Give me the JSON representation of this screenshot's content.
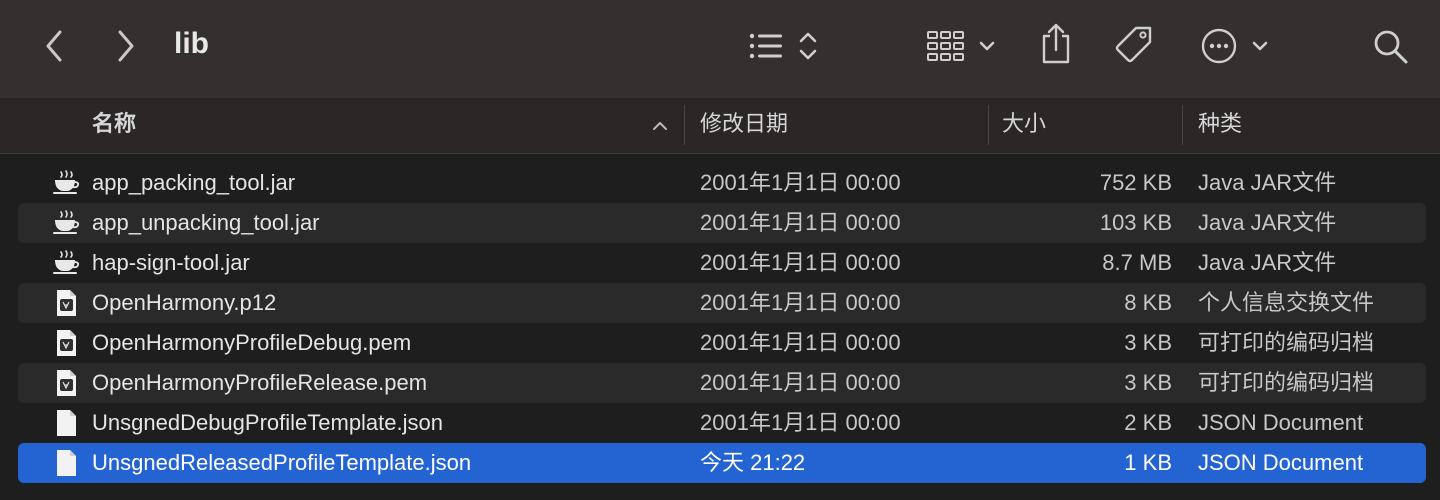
{
  "toolbar": {
    "title": "lib",
    "icons": [
      "back-icon",
      "forward-icon",
      "list-view-icon",
      "grid-view-icon",
      "share-icon",
      "tag-icon",
      "more-icon",
      "search-icon"
    ]
  },
  "columns": {
    "name": "名称",
    "date": "修改日期",
    "size": "大小",
    "kind": "种类"
  },
  "files": [
    {
      "name": "app_packing_tool.jar",
      "date": "2001年1月1日 00:00",
      "size": "752 KB",
      "kind": "Java JAR文件",
      "icon": "java-icon"
    },
    {
      "name": "app_unpacking_tool.jar",
      "date": "2001年1月1日 00:00",
      "size": "103 KB",
      "kind": "Java JAR文件",
      "icon": "java-icon"
    },
    {
      "name": "hap-sign-tool.jar",
      "date": "2001年1月1日 00:00",
      "size": "8.7 MB",
      "kind": "Java JAR文件",
      "icon": "java-icon"
    },
    {
      "name": "OpenHarmony.p12",
      "date": "2001年1月1日 00:00",
      "size": "8 KB",
      "kind": "个人信息交换文件",
      "icon": "certificate-icon"
    },
    {
      "name": "OpenHarmonyProfileDebug.pem",
      "date": "2001年1月1日 00:00",
      "size": "3 KB",
      "kind": "可打印的编码归档",
      "icon": "certificate-icon"
    },
    {
      "name": "OpenHarmonyProfileRelease.pem",
      "date": "2001年1月1日 00:00",
      "size": "3 KB",
      "kind": "可打印的编码归档",
      "icon": "certificate-icon"
    },
    {
      "name": "UnsgnedDebugProfileTemplate.json",
      "date": "2001年1月1日 00:00",
      "size": "2 KB",
      "kind": "JSON Document",
      "icon": "document-icon"
    },
    {
      "name": "UnsgnedReleasedProfileTemplate.json",
      "date": "今天 21:22",
      "size": "1 KB",
      "kind": "JSON Document",
      "icon": "document-icon"
    }
  ],
  "colors": {
    "selection": "#2463d2",
    "toolbar": "#352f2f",
    "background": "#1e1e1e"
  }
}
